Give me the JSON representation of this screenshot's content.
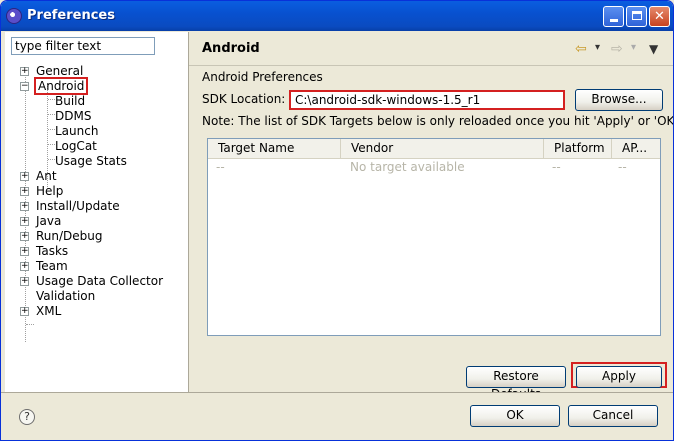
{
  "window": {
    "title": "Preferences"
  },
  "filter": {
    "placeholder": "type filter text"
  },
  "tree": {
    "items": [
      {
        "label": "General"
      },
      {
        "label": "Android"
      },
      {
        "label": "Build"
      },
      {
        "label": "DDMS"
      },
      {
        "label": "Launch"
      },
      {
        "label": "LogCat"
      },
      {
        "label": "Usage Stats"
      },
      {
        "label": "Ant"
      },
      {
        "label": "Help"
      },
      {
        "label": "Install/Update"
      },
      {
        "label": "Java"
      },
      {
        "label": "Run/Debug"
      },
      {
        "label": "Tasks"
      },
      {
        "label": "Team"
      },
      {
        "label": "Usage Data Collector"
      },
      {
        "label": "Validation"
      },
      {
        "label": "XML"
      }
    ]
  },
  "page": {
    "title": "Android",
    "section_label": "Android Preferences",
    "sdk_label": "SDK Location:",
    "sdk_value": "C:\\android-sdk-windows-1.5_r1",
    "browse_label": "Browse...",
    "note": "Note: The list of SDK Targets below is only reloaded once you hit 'Apply' or 'OK'."
  },
  "table": {
    "columns": [
      "Target Name",
      "Vendor",
      "Platform",
      "AP..."
    ],
    "rows": [
      {
        "target": "--",
        "vendor": "No target available",
        "platform": "--",
        "api": "--"
      }
    ]
  },
  "buttons": {
    "restore": "Restore Defaults",
    "apply": "Apply",
    "ok": "OK",
    "cancel": "Cancel"
  },
  "icons": {
    "app": "eclipse-icon",
    "help": "help-icon",
    "back": "back-arrow-icon",
    "forward": "forward-arrow-icon",
    "menu": "view-menu-icon"
  },
  "colors": {
    "highlight": "#d42020",
    "titlebar": "#0a5ee0"
  }
}
